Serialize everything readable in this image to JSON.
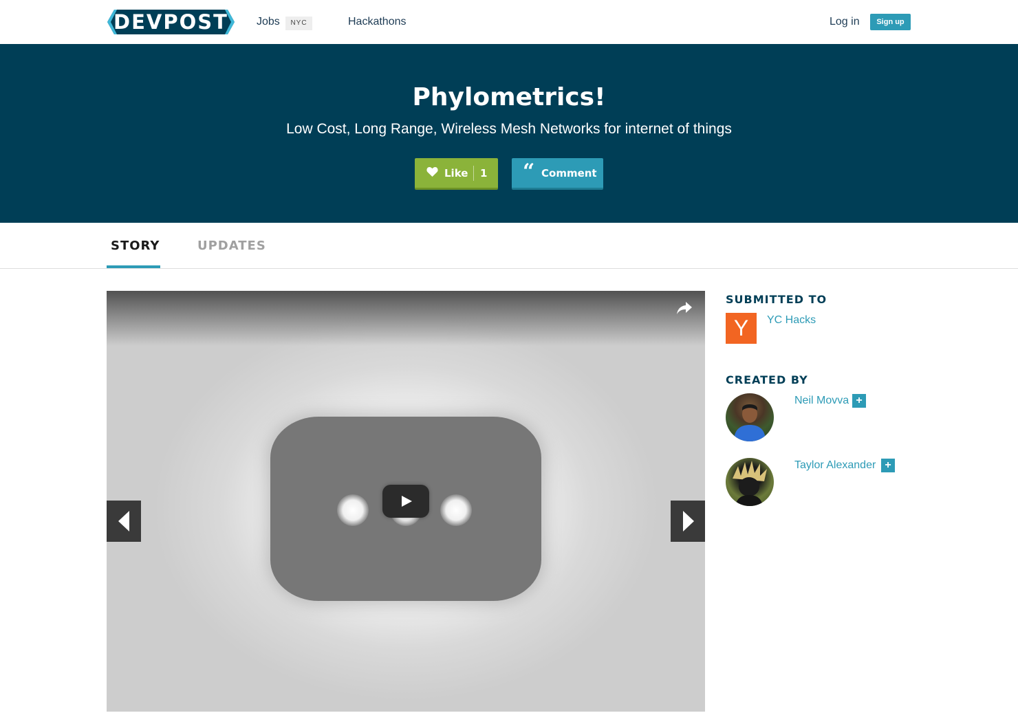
{
  "nav": {
    "logo_text": "DEVPOST",
    "jobs_label": "Jobs",
    "jobs_badge": "NYC",
    "hackathons_label": "Hackathons",
    "login_label": "Log in",
    "signup_label": "Sign up"
  },
  "hero": {
    "title": "Phylometrics!",
    "subtitle": "Low Cost, Long Range, Wireless Mesh Networks for internet of things",
    "like_label": "Like",
    "like_count": "1",
    "comment_label": "Comment",
    "comment_glyph": "“"
  },
  "tabs": [
    {
      "label": "STORY",
      "active": true
    },
    {
      "label": "UPDATES",
      "active": false
    }
  ],
  "sidebar": {
    "submitted_heading": "SUBMITTED TO",
    "hackathon": {
      "logo_letter": "Y",
      "name": "YC Hacks"
    },
    "created_heading": "CREATED BY",
    "creators": [
      {
        "name": "Neil Movva",
        "follow_glyph": "+"
      },
      {
        "name": "Taylor Alexander",
        "follow_glyph": "+"
      }
    ]
  },
  "colors": {
    "hero_bg": "#003e56",
    "accent": "#2d9bb6",
    "like_green": "#8bb33a",
    "yc_orange": "#f26522"
  },
  "icons": [
    "heart-icon",
    "quote-icon",
    "play-icon",
    "share-icon",
    "chevron-left-icon",
    "chevron-right-icon",
    "plus-icon"
  ]
}
